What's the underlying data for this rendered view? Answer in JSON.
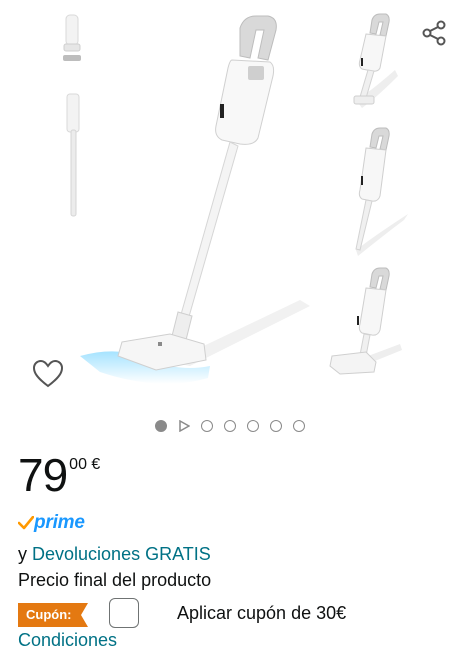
{
  "price": {
    "integer": "79",
    "fraction": "00 €"
  },
  "prime": {
    "label": "prime"
  },
  "returns": {
    "prefix": "y",
    "link": "Devoluciones GRATIS"
  },
  "final_price_note": "Precio final del producto",
  "coupon": {
    "badge": "Cupón:",
    "text": "Aplicar cupón de 30€",
    "conditions_link": "Condiciones"
  },
  "gallery": {
    "image_count": 7,
    "active_index": 0,
    "video_index": 1
  },
  "icons": {
    "share": "share-icon",
    "wishlist": "heart-outline-icon",
    "prime_check": "checkmark-icon",
    "video": "play-icon"
  },
  "colors": {
    "link": "#007185",
    "prime_blue": "#1a98ff",
    "prime_check": "#ff9900",
    "coupon_badge": "#e47911"
  }
}
